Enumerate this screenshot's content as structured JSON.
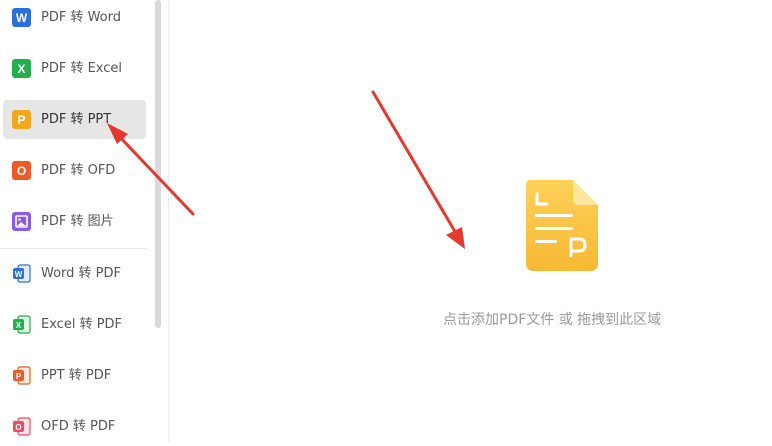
{
  "sidebar": {
    "items": [
      {
        "label": "PDF 转 Word",
        "icon": "word-icon"
      },
      {
        "label": "PDF 转 Excel",
        "icon": "excel-icon"
      },
      {
        "label": "PDF 转 PPT",
        "icon": "ppt-icon",
        "active": true
      },
      {
        "label": "PDF 转 OFD",
        "icon": "ofd-icon"
      },
      {
        "label": "PDF 转 图片",
        "icon": "image-icon"
      },
      {
        "label": "Word 转 PDF",
        "icon": "word-outline-icon"
      },
      {
        "label": "Excel 转 PDF",
        "icon": "excel-outline-icon"
      },
      {
        "label": "PPT 转 PDF",
        "icon": "ppt-outline-icon"
      },
      {
        "label": "OFD 转 PDF",
        "icon": "ofd-outline-icon"
      }
    ]
  },
  "main": {
    "drop_hint": "点击添加PDF文件 或 拖拽到此区域",
    "drop_icon": "pdf-file-icon"
  },
  "colors": {
    "word": "#2b6fdf",
    "excel": "#22b04a",
    "ppt": "#f2a81a",
    "ofd": "#ef5b26",
    "image": "#8d5be3",
    "file_icon": "#fcc744",
    "annotation_arrow": "#e6382e"
  }
}
